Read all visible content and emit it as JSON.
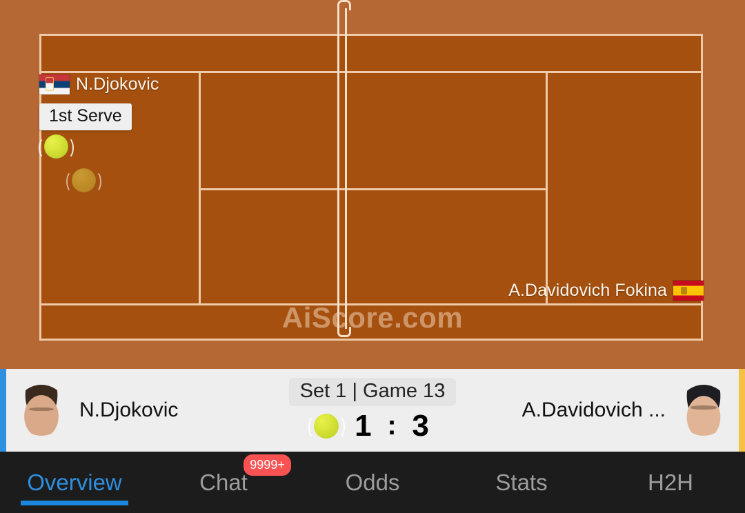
{
  "court": {
    "watermark": "AiScore.com",
    "serve_badge": "1st Serve",
    "top_player": {
      "name": "N.Djokovic",
      "flag": "serbia-flag-icon"
    },
    "bottom_player": {
      "name": "A.Davidovich Fokina",
      "flag": "spain-flag-icon"
    },
    "balls": [
      {
        "name": "current-serve-ball",
        "state": "current"
      },
      {
        "name": "previous-serve-ball",
        "state": "faded"
      }
    ],
    "surface_color": "#a5500f",
    "surround_color": "#b56734",
    "line_color": "#f0cba9"
  },
  "scoreboard": {
    "left_accent_color": "#2e8fe0",
    "right_accent_color": "#f5c246",
    "home": {
      "name": "N.Djokovic",
      "avatar": "player-photo-djokovic",
      "score": "1"
    },
    "away": {
      "name": "A.Davidovich ...",
      "avatar": "player-photo-davidovich",
      "score": "3"
    },
    "set_game": "Set 1 | Game 13",
    "separator": ":",
    "serving": "home"
  },
  "tabs": [
    {
      "label": "Overview",
      "active": true,
      "badge": null
    },
    {
      "label": "Chat",
      "active": false,
      "badge": "9999+"
    },
    {
      "label": "Odds",
      "active": false,
      "badge": null
    },
    {
      "label": "Stats",
      "active": false,
      "badge": null
    },
    {
      "label": "H2H",
      "active": false,
      "badge": null
    }
  ]
}
